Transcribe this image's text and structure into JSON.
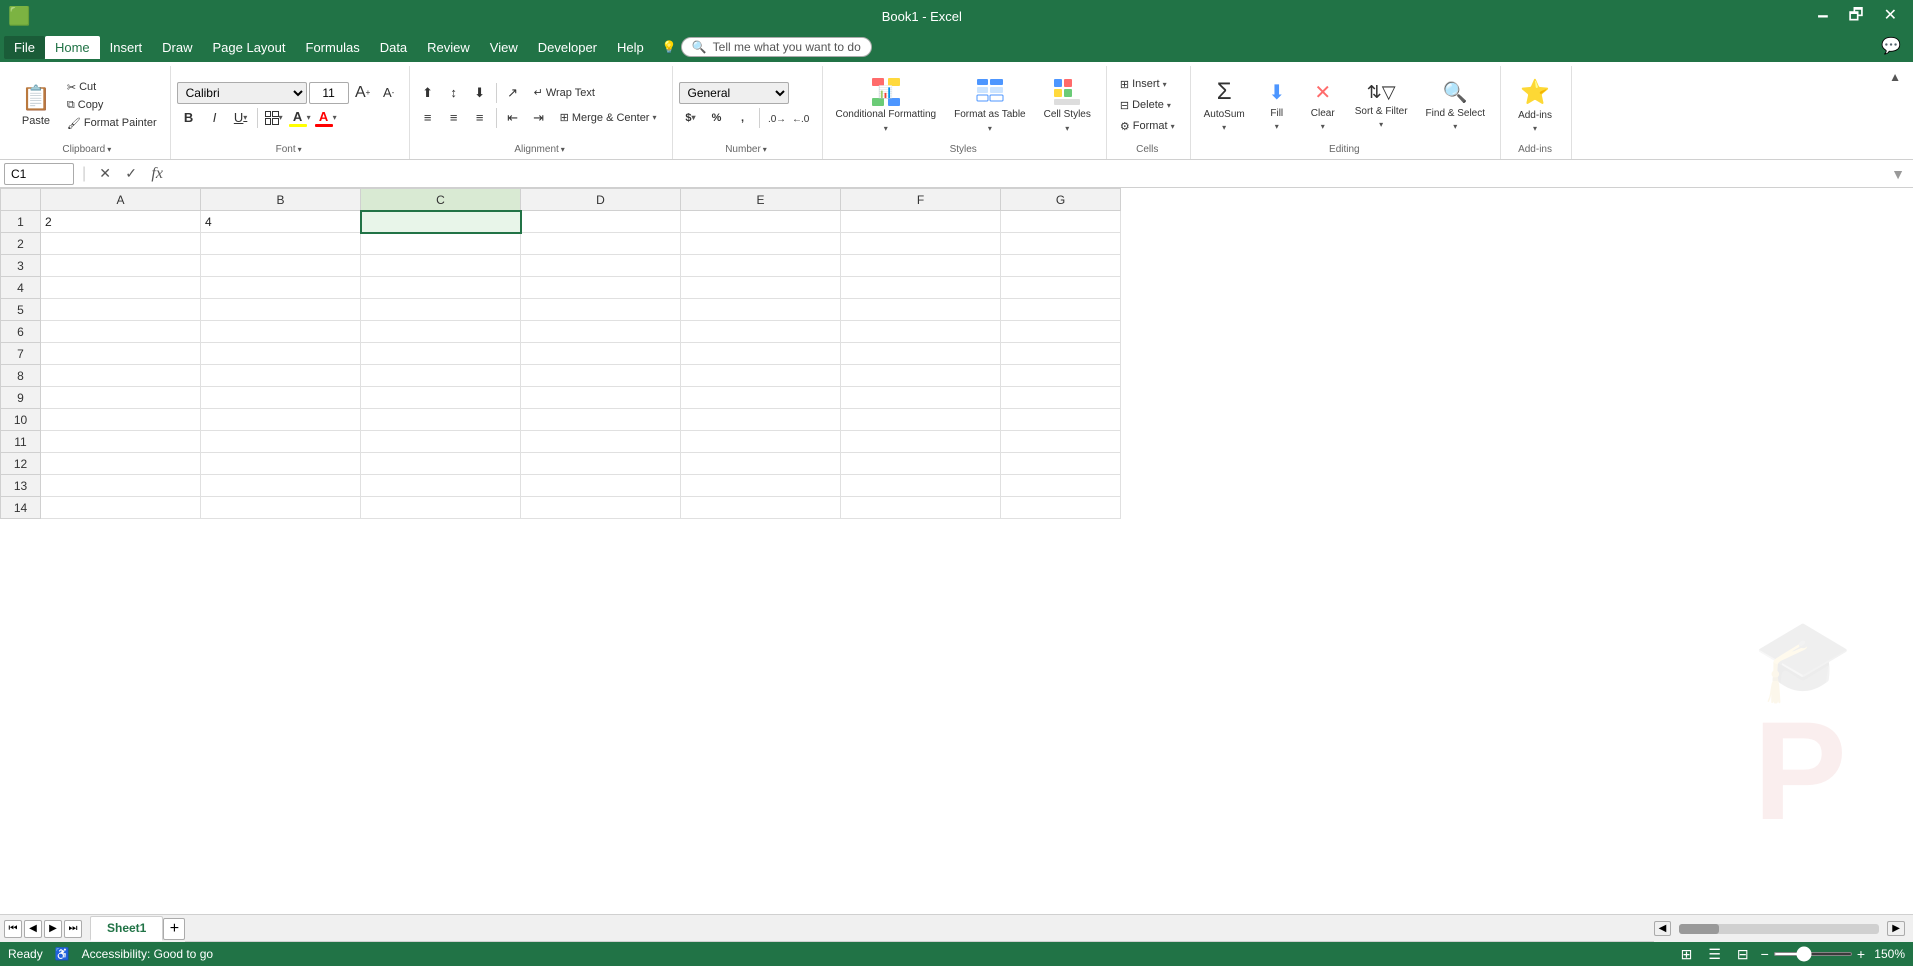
{
  "titleBar": {
    "title": "Book1 - Excel",
    "minimize": "🗕",
    "restore": "🗗",
    "close": "✕"
  },
  "menuBar": {
    "items": [
      "File",
      "Home",
      "Insert",
      "Draw",
      "Page Layout",
      "Formulas",
      "Data",
      "Review",
      "View",
      "Developer",
      "Help"
    ],
    "activeItem": "Home",
    "tellMe": "Tell me what you want to do"
  },
  "ribbon": {
    "clipboard": {
      "label": "Clipboard",
      "paste": "Paste",
      "cut": "Cut",
      "copy": "Copy",
      "formatPainter": "Format Painter"
    },
    "font": {
      "label": "Font",
      "fontName": "Calibri",
      "fontSize": "11",
      "bold": "B",
      "italic": "I",
      "underline": "U",
      "increaseFontSize": "A",
      "decreaseFontSize": "A",
      "borders": "⊞",
      "fillColor": "A",
      "fontColor": "A"
    },
    "alignment": {
      "label": "Alignment",
      "alignTop": "⬆",
      "alignMiddle": "↕",
      "alignBottom": "⬇",
      "wrapText": "Wrap Text",
      "mergeCenter": "Merge & Center",
      "alignLeft": "◁",
      "alignCenter": "◈",
      "alignRight": "▷",
      "decreaseIndent": "⇤",
      "increaseIndent": "⇥",
      "orientation": "↗"
    },
    "number": {
      "label": "Number",
      "format": "General",
      "accountingFormat": "$",
      "percent": "%",
      "comma": ",",
      "increaseDecimal": ".0",
      "decreaseDecimal": ".00"
    },
    "styles": {
      "label": "Styles",
      "conditionalFormatting": "Conditional Formatting",
      "formatAsTable": "Format as Table",
      "cellStyles": "Cell Styles"
    },
    "cells": {
      "label": "Cells",
      "insert": "Insert",
      "delete": "Delete",
      "format": "Format"
    },
    "editing": {
      "label": "Editing",
      "autoSum": "Σ",
      "fill": "Fill",
      "clear": "Clear",
      "sortFilter": "Sort & Filter",
      "findSelect": "Find & Select"
    },
    "addins": {
      "label": "Add-ins",
      "addins": "Add-ins"
    }
  },
  "formulaBar": {
    "cellRef": "C1",
    "cancelBtn": "✕",
    "confirmBtn": "✓",
    "insertFunction": "fx",
    "formula": ""
  },
  "grid": {
    "columns": [
      "",
      "A",
      "B",
      "C",
      "D",
      "E",
      "F",
      "G"
    ],
    "selectedCell": "C1",
    "rows": [
      {
        "num": 1,
        "A": "2",
        "B": "4",
        "C": "",
        "D": "",
        "E": "",
        "F": "",
        "G": ""
      },
      {
        "num": 2,
        "A": "",
        "B": "",
        "C": "",
        "D": "",
        "E": "",
        "F": "",
        "G": ""
      },
      {
        "num": 3,
        "A": "",
        "B": "",
        "C": "",
        "D": "",
        "E": "",
        "F": "",
        "G": ""
      },
      {
        "num": 4,
        "A": "",
        "B": "",
        "C": "",
        "D": "",
        "E": "",
        "F": "",
        "G": ""
      },
      {
        "num": 5,
        "A": "",
        "B": "",
        "C": "",
        "D": "",
        "E": "",
        "F": "",
        "G": ""
      },
      {
        "num": 6,
        "A": "",
        "B": "",
        "C": "",
        "D": "",
        "E": "",
        "F": "",
        "G": ""
      },
      {
        "num": 7,
        "A": "",
        "B": "",
        "C": "",
        "D": "",
        "E": "",
        "F": "",
        "G": ""
      },
      {
        "num": 8,
        "A": "",
        "B": "",
        "C": "",
        "D": "",
        "E": "",
        "F": "",
        "G": ""
      },
      {
        "num": 9,
        "A": "",
        "B": "",
        "C": "",
        "D": "",
        "E": "",
        "F": "",
        "G": ""
      },
      {
        "num": 10,
        "A": "",
        "B": "",
        "C": "",
        "D": "",
        "E": "",
        "F": "",
        "G": ""
      },
      {
        "num": 11,
        "A": "",
        "B": "",
        "C": "",
        "D": "",
        "E": "",
        "F": "",
        "G": ""
      },
      {
        "num": 12,
        "A": "",
        "B": "",
        "C": "",
        "D": "",
        "E": "",
        "F": "",
        "G": ""
      },
      {
        "num": 13,
        "A": "",
        "B": "",
        "C": "",
        "D": "",
        "E": "",
        "F": "",
        "G": ""
      },
      {
        "num": 14,
        "A": "",
        "B": "",
        "C": "",
        "D": "",
        "E": "",
        "F": "",
        "G": ""
      }
    ]
  },
  "sheetTabs": {
    "sheets": [
      "Sheet1"
    ],
    "activeSheet": "Sheet1"
  },
  "statusBar": {
    "ready": "Ready",
    "accessibility": "Accessibility: Good to go",
    "zoom": "150%"
  },
  "colors": {
    "green": "#217346",
    "lightGreen": "#e8f5e9",
    "borderColor": "#d0d0d0",
    "selectedBorder": "#217346"
  }
}
